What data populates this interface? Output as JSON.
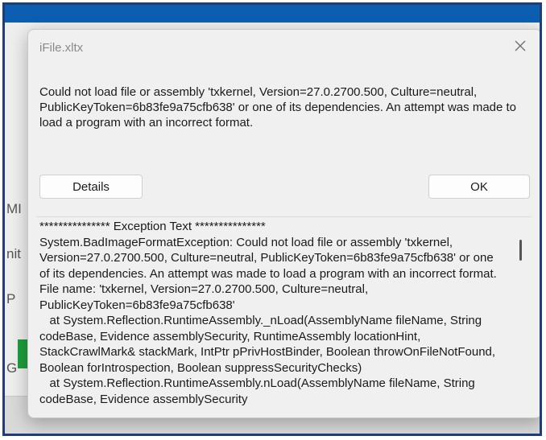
{
  "background": {
    "sidebar_labels": [
      "MI",
      "nit",
      "P",
      "G"
    ],
    "right_label": "%",
    "right_chevron": "chevron-right-icon"
  },
  "dialog": {
    "title": "iFile.xltx",
    "close_icon": "close-icon",
    "message": "Could not load file or assembly 'txkernel, Version=27.0.2700.500, Culture=neutral, PublicKeyToken=6b83fe9a75cfb638' or one of its dependencies. An attempt was made to load a program with an incorrect format.",
    "details_button": "Details",
    "ok_button": "OK",
    "details_text": "*************** Exception Text ***************\nSystem.BadImageFormatException: Could not load file or assembly 'txkernel, Version=27.0.2700.500, Culture=neutral, PublicKeyToken=6b83fe9a75cfb638' or one of its dependencies. An attempt was made to load a program with an incorrect format.\nFile name: 'txkernel, Version=27.0.2700.500, Culture=neutral, PublicKeyToken=6b83fe9a75cfb638'\n   at System.Reflection.RuntimeAssembly._nLoad(AssemblyName fileName, String codeBase, Evidence assemblySecurity, RuntimeAssembly locationHint, StackCrawlMark& stackMark, IntPtr pPrivHostBinder, Boolean throwOnFileNotFound, Boolean forIntrospection, Boolean suppressSecurityChecks)\n   at System.Reflection.RuntimeAssembly.nLoad(AssemblyName fileName, String codeBase, Evidence assemblySecurity"
  }
}
